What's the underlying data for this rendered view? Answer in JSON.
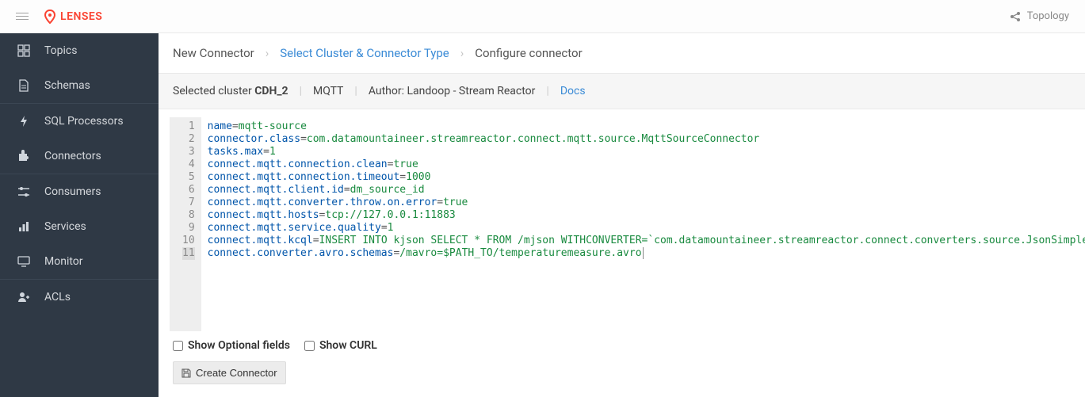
{
  "brand": "LENSES",
  "top_link": "Topology",
  "sidebar": {
    "groups": [
      {
        "items": [
          {
            "label": "Topics",
            "icon": "grid"
          },
          {
            "label": "Schemas",
            "icon": "doc"
          }
        ]
      },
      {
        "items": [
          {
            "label": "SQL Processors",
            "icon": "bolt"
          },
          {
            "label": "Connectors",
            "icon": "puzzle"
          }
        ]
      },
      {
        "items": [
          {
            "label": "Consumers",
            "icon": "sliders"
          },
          {
            "label": "Services",
            "icon": "bars"
          },
          {
            "label": "Monitor",
            "icon": "screen"
          }
        ]
      },
      {
        "items": [
          {
            "label": "ACLs",
            "icon": "person"
          }
        ]
      }
    ]
  },
  "breadcrumbs": {
    "root": "New Connector",
    "step_link": "Select Cluster & Connector Type",
    "current": "Configure connector"
  },
  "info": {
    "selected_label": "Selected cluster",
    "selected_cluster": "CDH_2",
    "connector_type": "MQTT",
    "author_label": "Author:",
    "author": "Landoop - Stream Reactor",
    "docs_label": "Docs"
  },
  "editor": {
    "lines": [
      {
        "key": "name",
        "val": "mqtt-source"
      },
      {
        "key": "connector.class",
        "val": "com.datamountaineer.streamreactor.connect.mqtt.source.MqttSourceConnector"
      },
      {
        "key": "tasks.max",
        "val": "1"
      },
      {
        "key": "connect.mqtt.connection.clean",
        "val": "true"
      },
      {
        "key": "connect.mqtt.connection.timeout",
        "val": "1000"
      },
      {
        "key": "connect.mqtt.client.id",
        "val": "dm_source_id"
      },
      {
        "key": "connect.mqtt.converter.throw.on.error",
        "val": "true"
      },
      {
        "key": "connect.mqtt.hosts",
        "val": "tcp://127.0.0.1:11883"
      },
      {
        "key": "connect.mqtt.service.quality",
        "val": "1"
      },
      {
        "key": "connect.mqtt.kcql",
        "val": "INSERT INTO kjson SELECT * FROM /mjson WITHCONVERTER=`com.datamountaineer.streamreactor.connect.converters.source.JsonSimpleConverter`"
      },
      {
        "key": "connect.converter.avro.schemas",
        "val": "/mavro=$PATH_TO/temperaturemeasure.avro"
      }
    ],
    "active_line": 11
  },
  "options": {
    "show_optional": "Show Optional fields",
    "show_curl": "Show CURL"
  },
  "button": "Create Connector"
}
